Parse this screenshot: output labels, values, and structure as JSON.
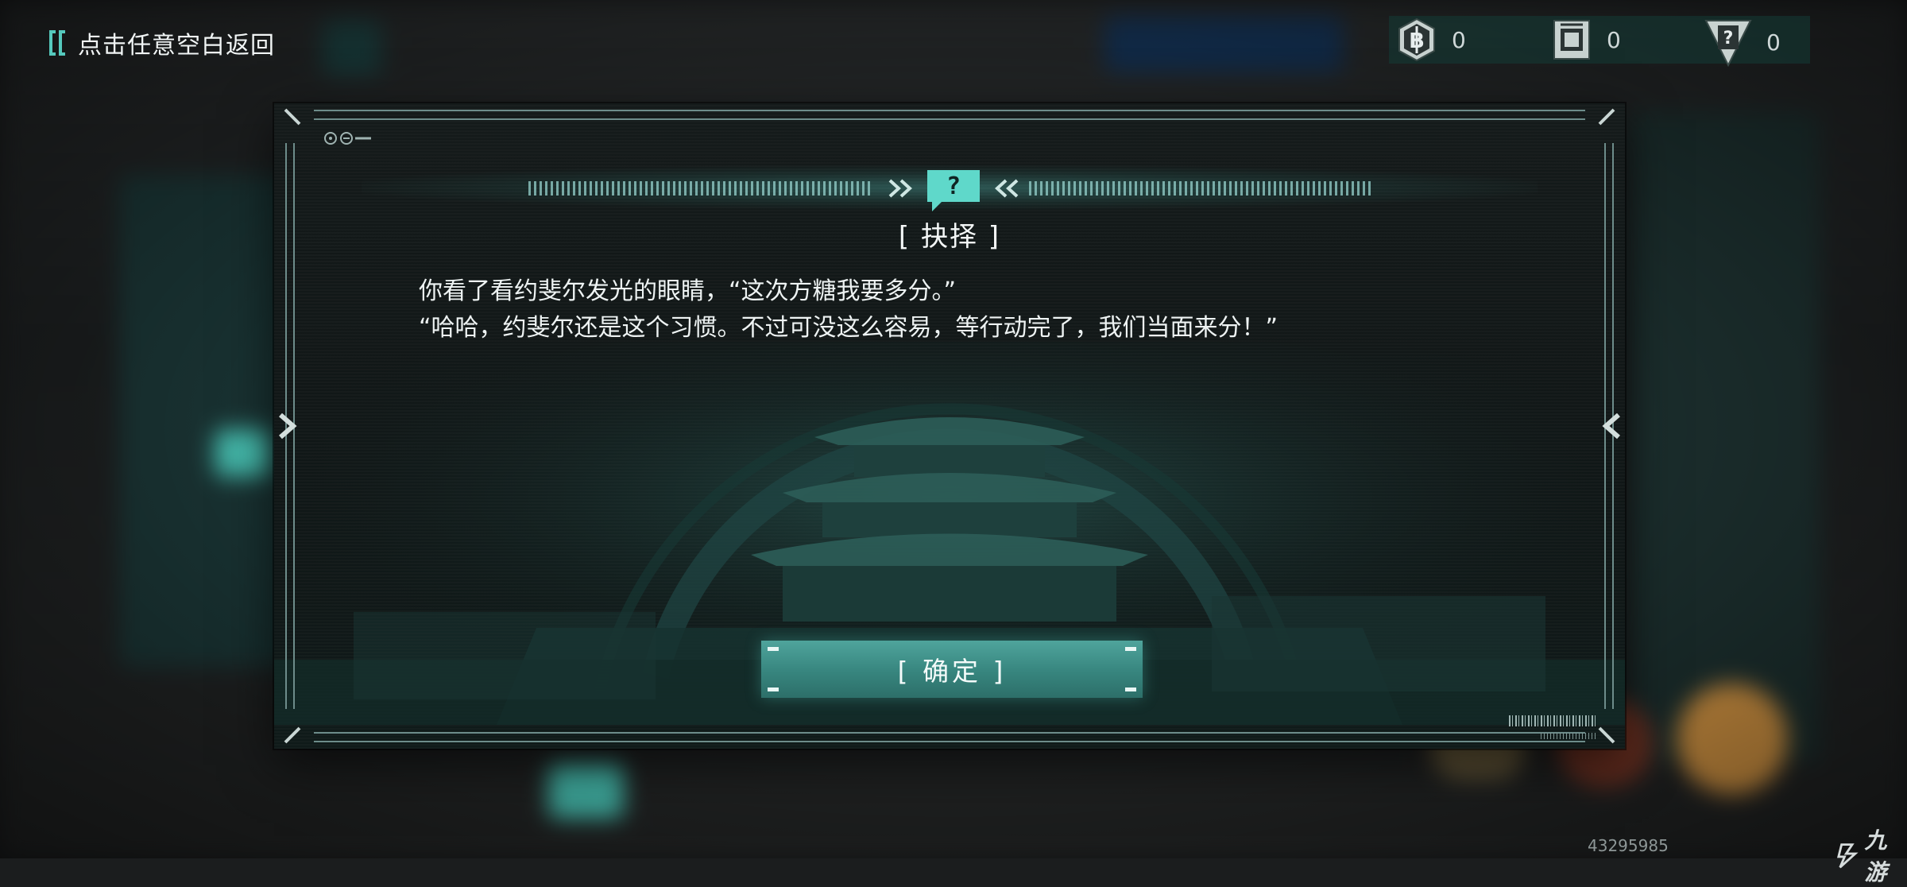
{
  "topbar": {
    "back_label": "点击任意空白返回",
    "resources": [
      {
        "icon": "coin-b-icon",
        "count": "0"
      },
      {
        "icon": "chip-card-icon",
        "count": "0"
      },
      {
        "icon": "question-card-icon",
        "count": "0"
      }
    ]
  },
  "dialog": {
    "title": "[ 抉择 ]",
    "badge_icon": "question-mark-icon",
    "story_lines": [
      "你看了看约斐尔发光的眼睛，“这次方糖我要多分。”",
      "“哈哈，约斐尔还是这个习惯。不过可没这么容易，等行动完了，我们当面来分！”"
    ],
    "confirm_label": "[ 确定 ]"
  },
  "watermark": {
    "id": "43295985",
    "logo_text": "九游"
  },
  "colors": {
    "accent": "#55c9bd",
    "confirm_button": "#3f8f88",
    "text": "#eef3f3"
  }
}
